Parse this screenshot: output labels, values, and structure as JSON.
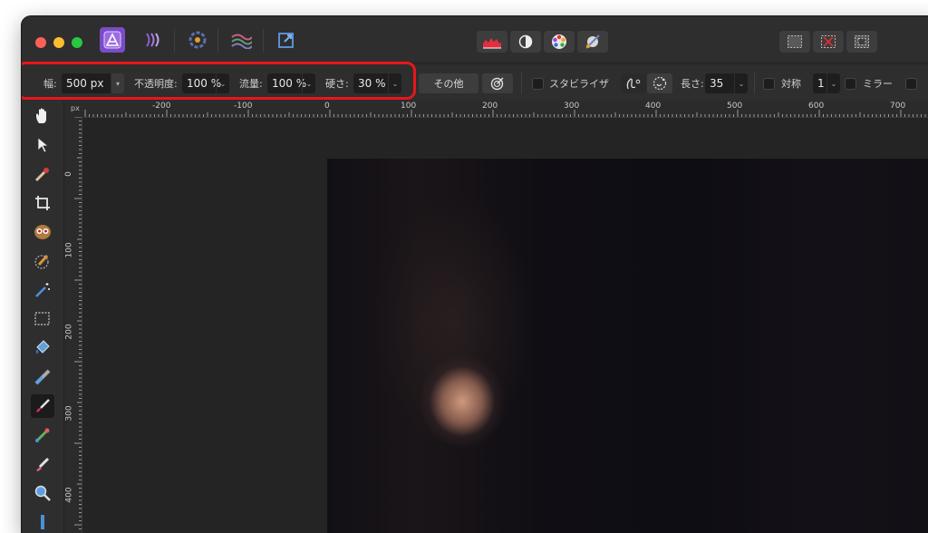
{
  "context_bar": {
    "width_label": "幅:",
    "width_value": "500 px",
    "opacity_label": "不透明度:",
    "opacity_value": "100 %",
    "flow_label": "流量:",
    "flow_value": "100 %",
    "hardness_label": "硬さ:",
    "hardness_value": "30 %",
    "more_button": "その他",
    "stabilizer_label": "スタビライザ",
    "length_label": "長さ:",
    "length_value": "35",
    "symmetry_label": "対称",
    "symmetry_value": "1",
    "mirror_label": "ミラー"
  },
  "ruler": {
    "unit": "px",
    "h_ticks": [
      "-200",
      "-100",
      "0",
      "100",
      "200",
      "300",
      "400",
      "500",
      "600",
      "700"
    ],
    "v_ticks": [
      "0",
      "100",
      "200",
      "300",
      "400"
    ]
  },
  "colors": {
    "highlight": "#e8161b",
    "persona_active": "#7a4cc7",
    "window_bg": "#2b2b2b"
  },
  "icons": {
    "personas": [
      "photo-persona-icon",
      "liquify-persona-icon",
      "develop-persona-icon",
      "tone-mapping-persona-icon",
      "export-persona-icon"
    ],
    "top_toolbar": [
      "histogram-icon",
      "auto-contrast-icon",
      "color-wheel-icon",
      "white-balance-icon"
    ],
    "selection": [
      "select-all-icon",
      "deselect-icon",
      "invert-selection-icon"
    ],
    "tools": [
      "hand-icon",
      "move-icon",
      "color-picker-icon",
      "crop-icon",
      "red-eye-icon",
      "selection-brush-icon",
      "magic-wand-icon",
      "marquee-icon",
      "flood-fill-icon",
      "gradient-icon",
      "paint-brush-icon",
      "clone-icon",
      "erase-icon",
      "zoom-icon",
      "more-tools-icon"
    ]
  }
}
